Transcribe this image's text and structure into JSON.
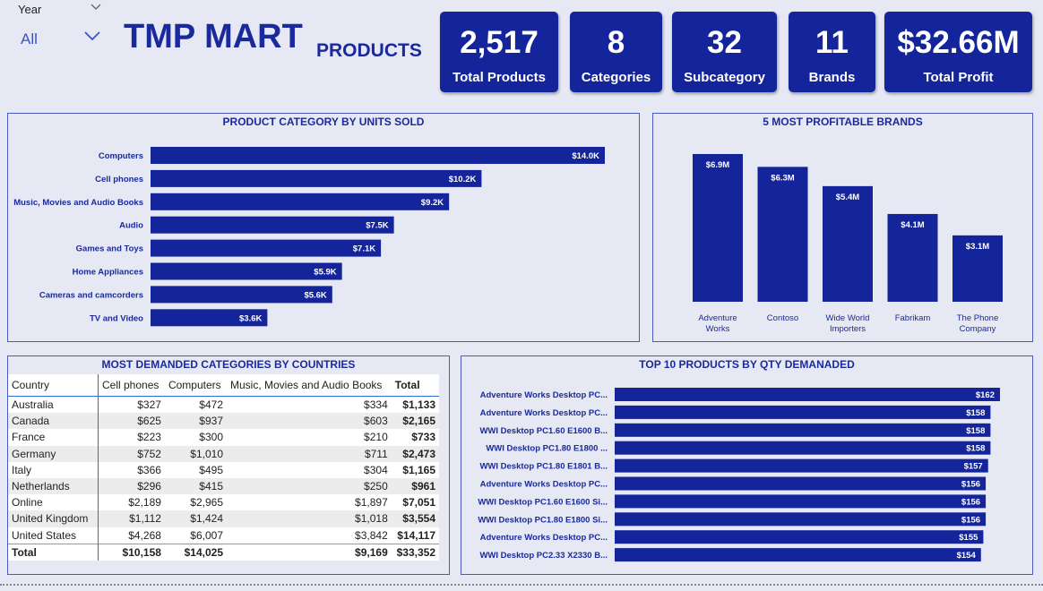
{
  "filter": {
    "label": "Year",
    "value": "All"
  },
  "title": {
    "main": "TMP MART",
    "sub": "PRODUCTS"
  },
  "kpis": [
    {
      "value": "2,517",
      "label": "Total Products"
    },
    {
      "value": "8",
      "label": "Categories"
    },
    {
      "value": "32",
      "label": "Subcategory"
    },
    {
      "value": "11",
      "label": "Brands"
    },
    {
      "value": "$32.66M",
      "label": "Total Profit"
    }
  ],
  "panels": {
    "units": "PRODUCT CATEGORY BY UNITS SOLD",
    "brands": "5 MOST PROFITABLE BRANDS",
    "countries": "MOST DEMANDED CATEGORIES BY COUNTRIES",
    "top10": "TOP 10 PRODUCTS BY QTY DEMANADED"
  },
  "colors": {
    "bar": "#14249a",
    "card": "#14249a",
    "title": "#1a2a9c",
    "background": "#e6e8f4"
  },
  "chart_data": [
    {
      "type": "bar",
      "orientation": "horizontal",
      "title": "PRODUCT CATEGORY BY UNITS SOLD",
      "categories": [
        "Computers",
        "Cell phones",
        "Music, Movies and Audio Books",
        "Audio",
        "Games and Toys",
        "Home Appliances",
        "Cameras and camcorders",
        "TV and Video"
      ],
      "values": [
        14.0,
        10.2,
        9.2,
        7.5,
        7.1,
        5.9,
        5.6,
        3.6
      ],
      "labels": [
        "$14.0K",
        "$10.2K",
        "$9.2K",
        "$7.5K",
        "$7.1K",
        "$5.9K",
        "$5.6K",
        "$3.6K"
      ],
      "unit": "K",
      "xlim": [
        0,
        14.0
      ]
    },
    {
      "type": "bar",
      "orientation": "vertical",
      "title": "5 MOST PROFITABLE BRANDS",
      "categories": [
        [
          "Adventure",
          "Works"
        ],
        [
          "Contoso"
        ],
        [
          "Wide World",
          "Importers"
        ],
        [
          "Fabrikam"
        ],
        [
          "The Phone",
          "Company"
        ]
      ],
      "values": [
        6.9,
        6.3,
        5.4,
        4.1,
        3.1
      ],
      "labels": [
        "$6.9M",
        "$6.3M",
        "$5.4M",
        "$4.1M",
        "$3.1M"
      ],
      "unit": "M",
      "ylim": [
        0,
        6.9
      ]
    },
    {
      "type": "table",
      "title": "MOST DEMANDED CATEGORIES BY COUNTRIES",
      "columns": [
        "Country",
        "Cell phones",
        "Computers",
        "Music, Movies and Audio Books",
        "Total"
      ],
      "rows": [
        [
          "Australia",
          "$327",
          "$472",
          "$334",
          "$1,133"
        ],
        [
          "Canada",
          "$625",
          "$937",
          "$603",
          "$2,165"
        ],
        [
          "France",
          "$223",
          "$300",
          "$210",
          "$733"
        ],
        [
          "Germany",
          "$752",
          "$1,010",
          "$711",
          "$2,473"
        ],
        [
          "Italy",
          "$366",
          "$495",
          "$304",
          "$1,165"
        ],
        [
          "Netherlands",
          "$296",
          "$415",
          "$250",
          "$961"
        ],
        [
          "Online",
          "$2,189",
          "$2,965",
          "$1,897",
          "$7,051"
        ],
        [
          "United Kingdom",
          "$1,112",
          "$1,424",
          "$1,018",
          "$3,554"
        ],
        [
          "United States",
          "$4,268",
          "$6,007",
          "$3,842",
          "$14,117"
        ]
      ],
      "total": [
        "Total",
        "$10,158",
        "$14,025",
        "$9,169",
        "$33,352"
      ]
    },
    {
      "type": "bar",
      "orientation": "horizontal",
      "title": "TOP 10 PRODUCTS BY QTY DEMANADED",
      "categories": [
        "Adventure Works Desktop PC...",
        "Adventure Works Desktop PC...",
        "WWI Desktop PC1.60 E1600 B...",
        "WWI Desktop PC1.80 E1800 ...",
        "WWI Desktop PC1.80 E1801 B...",
        "Adventure Works Desktop PC...",
        "WWI Desktop PC1.60 E1600 Si...",
        "WWI Desktop PC1.80 E1800 Si...",
        "Adventure Works Desktop PC...",
        "WWI Desktop PC2.33 X2330 B..."
      ],
      "values": [
        162,
        158,
        158,
        158,
        157,
        156,
        156,
        156,
        155,
        154
      ],
      "labels": [
        "$162",
        "$158",
        "$158",
        "$158",
        "$157",
        "$156",
        "$156",
        "$156",
        "$155",
        "$154"
      ],
      "xlim": [
        0,
        162
      ]
    }
  ]
}
